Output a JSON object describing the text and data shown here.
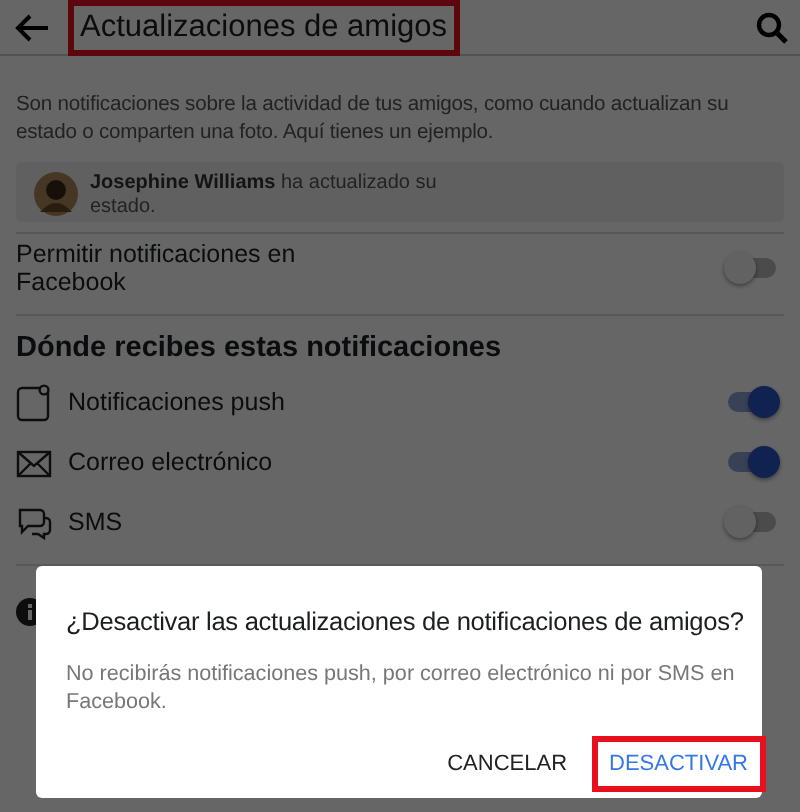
{
  "header": {
    "title": "Actualizaciones de amigos",
    "title_highlighted": true
  },
  "description": "Son notificaciones sobre la actividad de tus amigos, como cuando actualizan su estado o comparten una foto. Aquí tienes un ejemplo.",
  "example": {
    "text": "**Josephine Williams** ha actualizado su estado."
  },
  "allow": {
    "label": "Permitir notificaciones en Facebook",
    "on": false
  },
  "section_title": "Dónde recibes estas notificaciones",
  "channels": [
    {
      "kind": "push",
      "label": "Notificaciones push",
      "on": true
    },
    {
      "kind": "email",
      "label": "Correo electrónico",
      "on": true
    },
    {
      "kind": "sms",
      "label": "SMS",
      "on": false
    }
  ],
  "dialog": {
    "title": "¿Desactivar las actualizaciones de notificaciones de amigos?",
    "body": "No recibirás notificaciones push, por correo electrónico ni por SMS en Facebook.",
    "buttons": [
      {
        "label": "CANCELAR",
        "kind": "plain",
        "highlighted": false
      },
      {
        "label": "DESACTIVAR",
        "kind": "primary",
        "highlighted": true
      }
    ]
  }
}
